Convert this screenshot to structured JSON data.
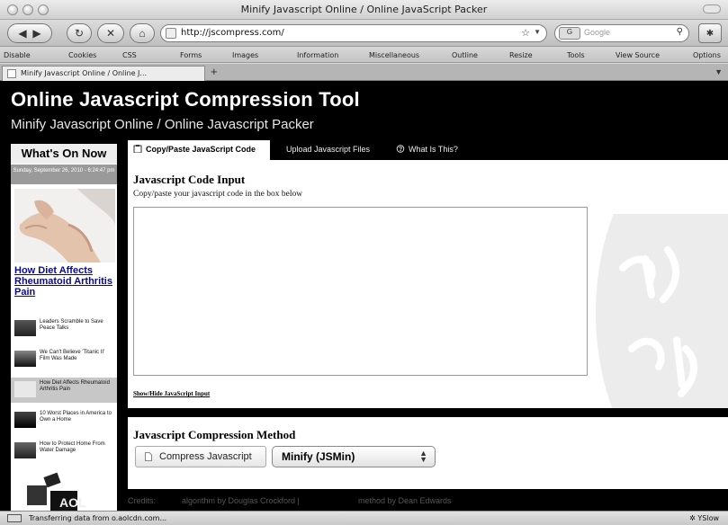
{
  "window": {
    "title": "Minify Javascript Online / Online JavaScript Packer"
  },
  "toolbar": {
    "url": "http://jscompress.com/",
    "search_placeholder": "Google",
    "search_engine_label": "G"
  },
  "dev_toolbar": {
    "items": [
      "Disable",
      "Cookies",
      "CSS",
      "Forms",
      "Images",
      "Information",
      "Miscellaneous",
      "Outline",
      "Resize",
      "Tools",
      "View Source",
      "Options"
    ]
  },
  "browser_tab": {
    "label": "Minify Javascript Online / Online J...",
    "new_tab": "+"
  },
  "site": {
    "title": "Online Javascript Compression Tool",
    "subtitle": "Minify Javascript Online / Online Javascript Packer"
  },
  "sidebar": {
    "heading": "What's On Now",
    "date": "Sunday, September 26, 2010 - 6:24:47 pm",
    "feature_link": "How Diet Affects Rheumatoid Arthritis Pain",
    "stories": [
      "Leaders Scramble to Save Peace Talks",
      "We Can't Believe 'Titanic II' Film Was Made",
      "How Diet Affects Rheumatoid Arthritis Pain",
      "10 Worst Places in America to Own a Home",
      "How to Protect Home From Water Damage"
    ],
    "promo_text": "AOL"
  },
  "tabs": {
    "copy_paste": "Copy/Paste JavaScript Code",
    "upload": "Upload Javascript Files",
    "what_is_this": "What Is This?"
  },
  "input": {
    "heading": "Javascript Code Input",
    "description": "Copy/paste your javascript code in the box below",
    "toggle_link": "Show/Hide JavaScript Input"
  },
  "method": {
    "heading": "Javascript Compression Method",
    "compress_button": "Compress Javascript",
    "selected": "Minify (JSMin)"
  },
  "credits": {
    "label": "Credits:",
    "algorithm": "algorithm by Douglas Crockford |",
    "method": "method by Dean Edwards"
  },
  "status": {
    "text": "Transferring data from o.aolcdn.com...",
    "right": "YSlow"
  }
}
